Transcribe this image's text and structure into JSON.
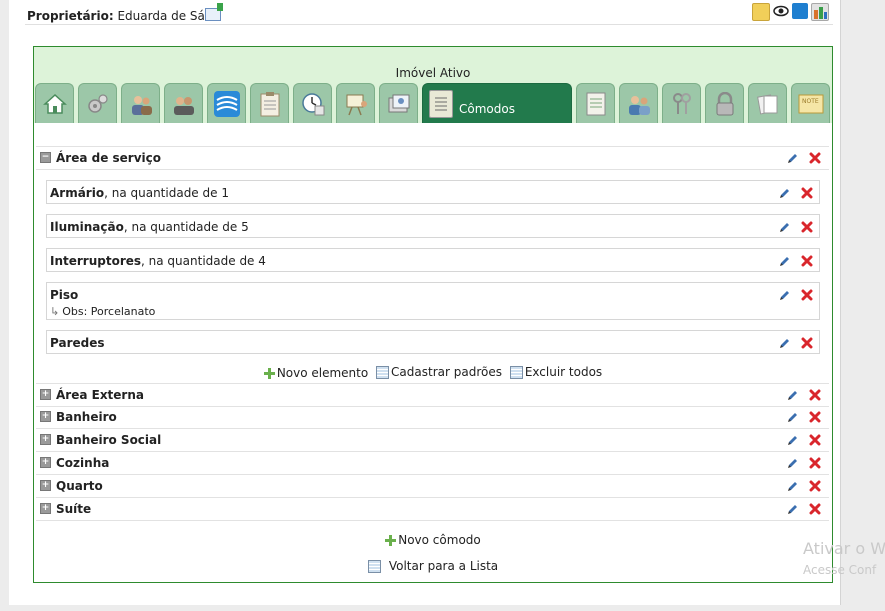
{
  "owner": {
    "label": "Proprietário:",
    "name": "Eduarda de Sá"
  },
  "panel": {
    "title": "Imóvel Ativo"
  },
  "tabs": {
    "active_label": "Cômodos",
    "icons": [
      "home-icon",
      "gears-icon",
      "people-icon",
      "group-icon",
      "wave-icon",
      "clipboard-icon",
      "clock-icon",
      "presentation-icon",
      "photos-icon",
      "rooms-icon",
      "checklist-icon",
      "users-icon",
      "keys-icon",
      "lock-icon",
      "documents-icon",
      "note-icon"
    ]
  },
  "section_open": {
    "name": "Área de serviço",
    "items": [
      {
        "name": "Armário",
        "suffix": ", na quantidade de 1"
      },
      {
        "name": "Iluminação",
        "suffix": ", na quantidade de 5"
      },
      {
        "name": "Interruptores",
        "suffix": ", na quantidade de 4"
      },
      {
        "name": "Piso",
        "suffix": "",
        "obs": "Obs: Porcelanato"
      },
      {
        "name": "Paredes",
        "suffix": ""
      }
    ],
    "links": {
      "new_element": "Novo elemento",
      "register_defaults": "Cadastrar padrões",
      "delete_all": "Excluir todos"
    }
  },
  "sections": [
    {
      "name": "Área Externa"
    },
    {
      "name": "Banheiro"
    },
    {
      "name": "Banheiro Social"
    },
    {
      "name": "Cozinha"
    },
    {
      "name": "Quarto"
    },
    {
      "name": "Suíte"
    }
  ],
  "footer": {
    "new_room": "Novo cômodo",
    "back_to_list": "Voltar para a Lista"
  },
  "watermark": {
    "line1": "Ativar o W",
    "line2": "Acesse Conf"
  },
  "colors": {
    "accent": "#227a4c",
    "border": "#2e8b2e",
    "header_bg": "#ddf3d9",
    "delete": "#d9262c"
  }
}
